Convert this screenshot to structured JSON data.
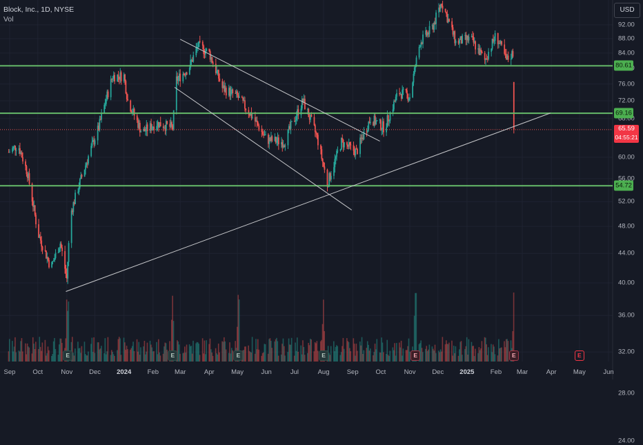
{
  "header": {
    "title": "Block, Inc., 1D, NYSE",
    "sub": "Vol",
    "currency": "USD"
  },
  "colors": {
    "up": "#26a69a",
    "down": "#ef5350",
    "level": "#66bb6a",
    "trendline": "#c8c9cc",
    "background": "#161a25"
  },
  "levels": [
    {
      "value": 80.61,
      "label": "80.61"
    },
    {
      "value": 69.16,
      "label": "69.16"
    },
    {
      "value": 54.72,
      "label": "54.72"
    }
  ],
  "last_price": {
    "value": 65.59,
    "label": "65.59",
    "countdown": "04:55:21"
  },
  "earnings_markers": [
    {
      "label": "E",
      "date": "2023-11-02",
      "kind": "past"
    },
    {
      "label": "E",
      "date": "2024-02-22",
      "kind": "past"
    },
    {
      "label": "E",
      "date": "2024-05-02",
      "kind": "past"
    },
    {
      "label": "E",
      "date": "2024-08-01",
      "kind": "past"
    },
    {
      "label": "E",
      "date": "2024-11-07",
      "kind": "neg"
    },
    {
      "label": "E",
      "date": "2025-02-20",
      "kind": "neg"
    },
    {
      "label": "E",
      "date": "2025-05-01",
      "kind": "future"
    }
  ],
  "chart_data": {
    "type": "candlestick",
    "title": "Block, Inc., 1D, NYSE",
    "series_name": "Vol",
    "y_axis": {
      "ticks": [
        "92.00",
        "88.00",
        "84.00",
        "80.00",
        "76.00",
        "72.00",
        "68.00",
        "60.00",
        "56.00",
        "52.00",
        "48.00",
        "44.00",
        "40.00",
        "36.00",
        "32.00",
        "28.00",
        "24.00"
      ],
      "scale": "log"
    },
    "x_axis": {
      "ticks": [
        "Sep",
        "Oct",
        "Nov",
        "Dec",
        "2024",
        "Feb",
        "Mar",
        "Apr",
        "May",
        "Jun",
        "Jul",
        "Aug",
        "Sep",
        "Oct",
        "Nov",
        "Dec",
        "2025",
        "Feb",
        "Mar",
        "Apr",
        "May",
        "Jun"
      ]
    },
    "approx_close_path": [
      {
        "date": "2023-08-31",
        "close": 61.0
      },
      {
        "date": "2023-09-10",
        "close": 62.5
      },
      {
        "date": "2023-09-20",
        "close": 57.0
      },
      {
        "date": "2023-10-01",
        "close": 47.0
      },
      {
        "date": "2023-10-15",
        "close": 42.0
      },
      {
        "date": "2023-10-25",
        "close": 45.5
      },
      {
        "date": "2023-11-01",
        "close": 40.5
      },
      {
        "date": "2023-11-05",
        "close": 50.0
      },
      {
        "date": "2023-11-20",
        "close": 58.0
      },
      {
        "date": "2023-12-05",
        "close": 66.0
      },
      {
        "date": "2023-12-20",
        "close": 78.0
      },
      {
        "date": "2024-01-01",
        "close": 78.0
      },
      {
        "date": "2024-01-05",
        "close": 72.0
      },
      {
        "date": "2024-01-20",
        "close": 65.0
      },
      {
        "date": "2024-02-05",
        "close": 67.0
      },
      {
        "date": "2024-02-22",
        "close": 66.0
      },
      {
        "date": "2024-02-26",
        "close": 77.0
      },
      {
        "date": "2024-03-10",
        "close": 80.0
      },
      {
        "date": "2024-03-20",
        "close": 86.0
      },
      {
        "date": "2024-04-01",
        "close": 84.0
      },
      {
        "date": "2024-04-15",
        "close": 75.0
      },
      {
        "date": "2024-05-01",
        "close": 73.0
      },
      {
        "date": "2024-05-15",
        "close": 69.0
      },
      {
        "date": "2024-06-01",
        "close": 63.5
      },
      {
        "date": "2024-06-20",
        "close": 63.0
      },
      {
        "date": "2024-07-10",
        "close": 72.0
      },
      {
        "date": "2024-07-25",
        "close": 64.0
      },
      {
        "date": "2024-08-05",
        "close": 55.0
      },
      {
        "date": "2024-08-20",
        "close": 63.0
      },
      {
        "date": "2024-09-05",
        "close": 61.0
      },
      {
        "date": "2024-09-20",
        "close": 68.0
      },
      {
        "date": "2024-10-05",
        "close": 66.0
      },
      {
        "date": "2024-10-20",
        "close": 74.0
      },
      {
        "date": "2024-11-01",
        "close": 73.0
      },
      {
        "date": "2024-11-12",
        "close": 87.0
      },
      {
        "date": "2024-11-25",
        "close": 91.0
      },
      {
        "date": "2024-12-05",
        "close": 99.0
      },
      {
        "date": "2024-12-20",
        "close": 87.0
      },
      {
        "date": "2025-01-05",
        "close": 88.0
      },
      {
        "date": "2025-01-20",
        "close": 82.0
      },
      {
        "date": "2025-02-01",
        "close": 89.0
      },
      {
        "date": "2025-02-12",
        "close": 82.0
      },
      {
        "date": "2025-02-19",
        "close": 84.0
      },
      {
        "date": "2025-02-21",
        "close": 65.59
      }
    ]
  }
}
